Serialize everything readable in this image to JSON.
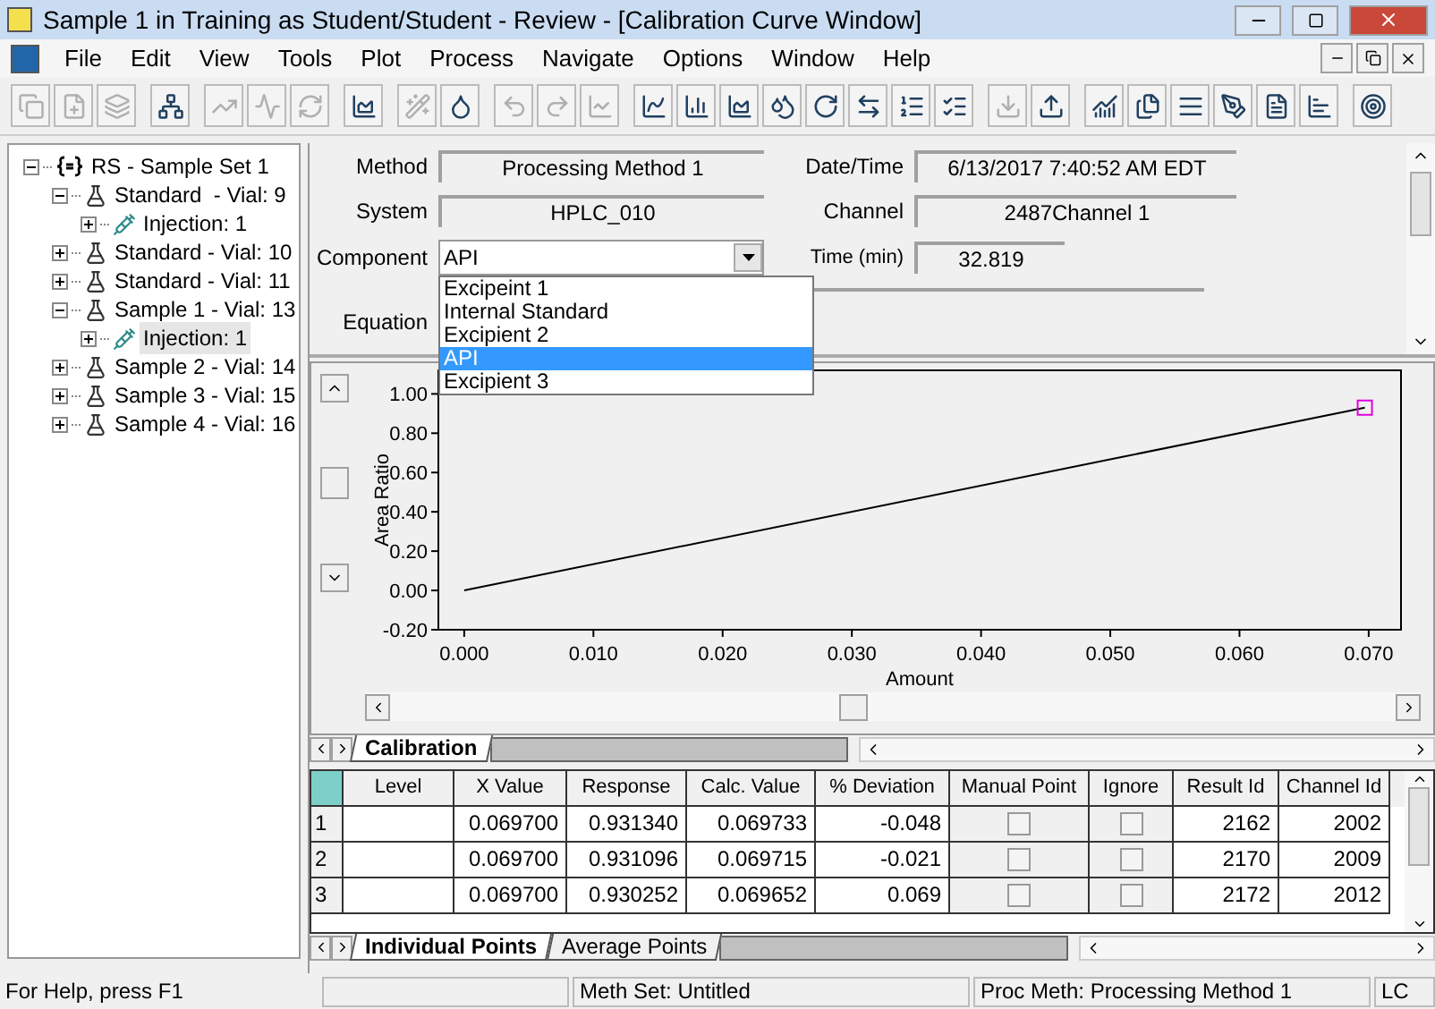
{
  "window": {
    "title": "Sample 1 in Training as Student/Student - Review - [Calibration Curve Window]"
  },
  "menu": [
    "File",
    "Edit",
    "View",
    "Tools",
    "Plot",
    "Process",
    "Navigate",
    "Options",
    "Window",
    "Help"
  ],
  "toolbar": [
    {
      "disabled": true
    },
    {
      "disabled": true
    },
    {
      "disabled": true
    },
    {
      "disabled": false
    },
    {
      "disabled": true
    },
    {
      "disabled": true
    },
    {
      "disabled": true
    },
    {
      "disabled": false
    },
    {
      "disabled": true
    },
    {
      "disabled": false
    },
    {
      "disabled": true
    },
    {
      "disabled": true
    },
    {
      "disabled": true
    },
    {
      "disabled": false
    },
    {
      "disabled": false
    },
    {
      "disabled": false
    },
    {
      "disabled": false
    },
    {
      "disabled": false
    },
    {
      "disabled": false
    },
    {
      "disabled": false
    },
    {
      "disabled": false
    },
    {
      "disabled": true
    },
    {
      "disabled": false
    },
    {
      "disabled": false
    },
    {
      "disabled": false
    },
    {
      "disabled": false
    },
    {
      "disabled": false
    },
    {
      "disabled": false
    },
    {
      "disabled": false
    },
    {
      "disabled": false
    }
  ],
  "tree": [
    {
      "label": "RS - Sample Set 1",
      "kind": "set",
      "expanded": true,
      "selected": false,
      "children": [
        {
          "label": "Standard  - Vial: 9",
          "kind": "vial",
          "expanded": true,
          "selected": false,
          "children": [
            {
              "label": "Injection: 1",
              "kind": "injection",
              "expanded": false,
              "selected": false
            }
          ]
        },
        {
          "label": "Standard - Vial: 10",
          "kind": "vial",
          "expanded": false,
          "selected": false
        },
        {
          "label": "Standard - Vial: 11",
          "kind": "vial",
          "expanded": false,
          "selected": false
        },
        {
          "label": "Sample 1 - Vial: 13",
          "kind": "vial",
          "expanded": true,
          "selected": false,
          "children": [
            {
              "label": "Injection: 1",
              "kind": "injection",
              "expanded": false,
              "selected": true
            }
          ]
        },
        {
          "label": "Sample 2 - Vial: 14",
          "kind": "vial",
          "expanded": false,
          "selected": false
        },
        {
          "label": "Sample 3 - Vial: 15",
          "kind": "vial",
          "expanded": false,
          "selected": false
        },
        {
          "label": "Sample 4 - Vial: 16",
          "kind": "vial",
          "expanded": false,
          "selected": false
        }
      ]
    }
  ],
  "info": {
    "method": {
      "label": "Method",
      "value": "Processing Method 1"
    },
    "date_time": {
      "label": "Date/Time",
      "value": "6/13/2017 7:40:52 AM EDT"
    },
    "system": {
      "label": "System",
      "value": "HPLC_010"
    },
    "channel": {
      "label": "Channel",
      "value": "2487Channel 1"
    },
    "component": {
      "label": "Component",
      "value": "API",
      "options": [
        {
          "label": "Excipeint 1",
          "selected": false
        },
        {
          "label": "Internal Standard",
          "selected": false
        },
        {
          "label": "Excipient 2",
          "selected": false
        },
        {
          "label": "API",
          "selected": true
        },
        {
          "label": "Excipient 3",
          "selected": false
        }
      ]
    },
    "time": {
      "label": "Time (min)",
      "value": "32.819"
    },
    "equation": {
      "label": "Equation"
    }
  },
  "chart_data": {
    "type": "line",
    "xlabel": "Amount",
    "ylabel": "Area Ratio",
    "x": [
      0,
      0.0697
    ],
    "series": [
      {
        "color": "#000000",
        "values": [
          0,
          0.93
        ]
      }
    ],
    "xlim": [
      -0.002,
      0.0725
    ],
    "ylim": [
      -0.2,
      1.12
    ],
    "xticks": [
      {
        "value": 0,
        "label": "0.000"
      },
      {
        "value": 0.01,
        "label": "0.010"
      },
      {
        "value": 0.02,
        "label": "0.020"
      },
      {
        "value": 0.03,
        "label": "0.030"
      },
      {
        "value": 0.04,
        "label": "0.040"
      },
      {
        "value": 0.05,
        "label": "0.050"
      },
      {
        "value": 0.06,
        "label": "0.060"
      },
      {
        "value": 0.07,
        "label": "0.070"
      }
    ],
    "yticks": [
      {
        "value": -0.2,
        "label": "-0.20"
      },
      {
        "value": 0,
        "label": "0.00"
      },
      {
        "value": 0.2,
        "label": "0.20"
      },
      {
        "value": 0.4,
        "label": "0.40"
      },
      {
        "value": 0.6,
        "label": "0.60"
      },
      {
        "value": 0.8,
        "label": "0.80"
      },
      {
        "value": 1,
        "label": "1.00"
      }
    ]
  },
  "plot_tabs": [
    {
      "label": "Calibration",
      "selected": true
    }
  ],
  "table": {
    "columns": [
      "Level",
      "X Value",
      "Response",
      "Calc. Value",
      "% Deviation",
      "Manual Point",
      "Ignore",
      "Result Id",
      "Channel Id"
    ],
    "rows": [
      {
        "number": "1",
        "level": "",
        "x_value": "0.069700",
        "response": "0.931340",
        "calc_value": "0.069733",
        "deviation": "-0.048",
        "manual_point": false,
        "ignore": false,
        "result_id": "2162",
        "channel_id": "2002"
      },
      {
        "number": "2",
        "level": "",
        "x_value": "0.069700",
        "response": "0.931096",
        "calc_value": "0.069715",
        "deviation": "-0.021",
        "manual_point": false,
        "ignore": false,
        "result_id": "2170",
        "channel_id": "2009"
      },
      {
        "number": "3",
        "level": "",
        "x_value": "0.069700",
        "response": "0.930252",
        "calc_value": "0.069652",
        "deviation": "0.069",
        "manual_point": false,
        "ignore": false,
        "result_id": "2172",
        "channel_id": "2012"
      }
    ]
  },
  "table_tabs": [
    {
      "label": "Individual Points",
      "selected": true
    },
    {
      "label": "Average Points",
      "selected": false
    }
  ],
  "status_bar": [
    "For Help, press F1",
    "Meth Set: Untitled",
    "Proc Meth: Processing Method 1",
    "LC"
  ]
}
